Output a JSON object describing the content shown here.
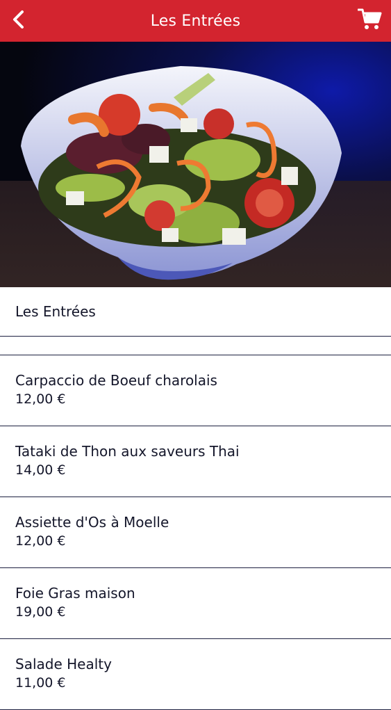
{
  "header": {
    "title": "Les Entrées",
    "back_icon": "chevron-left-icon",
    "cart_icon": "shopping-cart-icon",
    "bg_color": "#d3242f"
  },
  "hero": {
    "subject": "salad bowl photo"
  },
  "section": {
    "label": "Les Entrées"
  },
  "items": [
    {
      "name": "Carpaccio de Boeuf charolais",
      "price": "12,00 €"
    },
    {
      "name": "Tataki de Thon aux saveurs Thai",
      "price": "14,00 €"
    },
    {
      "name": "Assiette d'Os à Moelle",
      "price": "12,00 €"
    },
    {
      "name": "Foie Gras maison",
      "price": "19,00 €"
    },
    {
      "name": "Salade Healty",
      "price": "11,00 €"
    }
  ]
}
